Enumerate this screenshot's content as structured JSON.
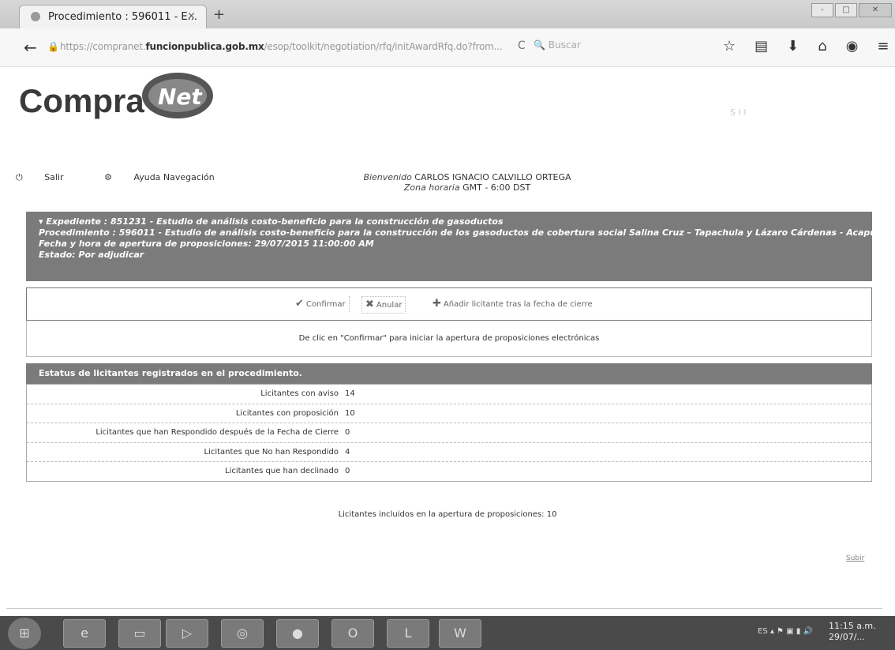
{
  "browser": {
    "tab_title": "Procedimiento : 596011 - E...",
    "tab_close": "×",
    "new_tab": "+",
    "url_prefix": "https://compranet.",
    "url_domain": "funcionpublica.gob.mx",
    "url_rest": "/esop/toolkit/negotiation/rfq/initAwardRfq.do?from...",
    "search_placeholder": "Buscar",
    "window_controls": [
      "-",
      "□",
      "✕"
    ]
  },
  "site": {
    "logo_word": "Compra",
    "logo_globe": "Net",
    "header_right": "S I I"
  },
  "userbar": {
    "salir": "Salir",
    "ayuda": "Ayuda Navegación",
    "welcome_label": "Bienvenido",
    "user_name": "CARLOS IGNACIO CALVILLO ORTEGA",
    "tz_label": "Zona horaria",
    "tz_value": "GMT - 6:00 DST"
  },
  "banner": {
    "expediente": "Expediente : 851231 - Estudio de análisis costo-beneficio para la construcción de gasoductos",
    "procedimiento": "Procedimiento : 596011 - Estudio de análisis costo-beneficio para la construcción de los gasoductos de cobertura social Salina Cruz – Tapachula y Lázaro Cárdenas - Acapulco",
    "fecha": "Fecha y hora de apertura de proposiciones: 29/07/2015 11:00:00 AM",
    "estado": "Estado: Por adjudicar"
  },
  "actions": {
    "confirmar": "Confirmar",
    "anular": "Anular",
    "anadir": "Añadir licitante tras la fecha de cierre"
  },
  "message": "De clic en \"Confirmar\" para iniciar la apertura de proposiciones electrónicas",
  "status": {
    "header": "Estatus de licitantes registrados en el procedimiento.",
    "rows": [
      {
        "label": "Licitantes con aviso",
        "value": "14"
      },
      {
        "label": "Licitantes con proposición",
        "value": "10"
      },
      {
        "label": "Licitantes que han Respondido después de la Fecha de Cierre",
        "value": "0"
      },
      {
        "label": "Licitantes que No han Respondido",
        "value": "4"
      },
      {
        "label": "Licitantes que han declinado",
        "value": "0"
      }
    ]
  },
  "included": "Licitantes incluidos en la apertura de proposiciones: 10",
  "subir": "Subir",
  "taskbar": {
    "tray_lang": "ES",
    "time": "11:15 a.m.",
    "date": "29/07/..."
  }
}
